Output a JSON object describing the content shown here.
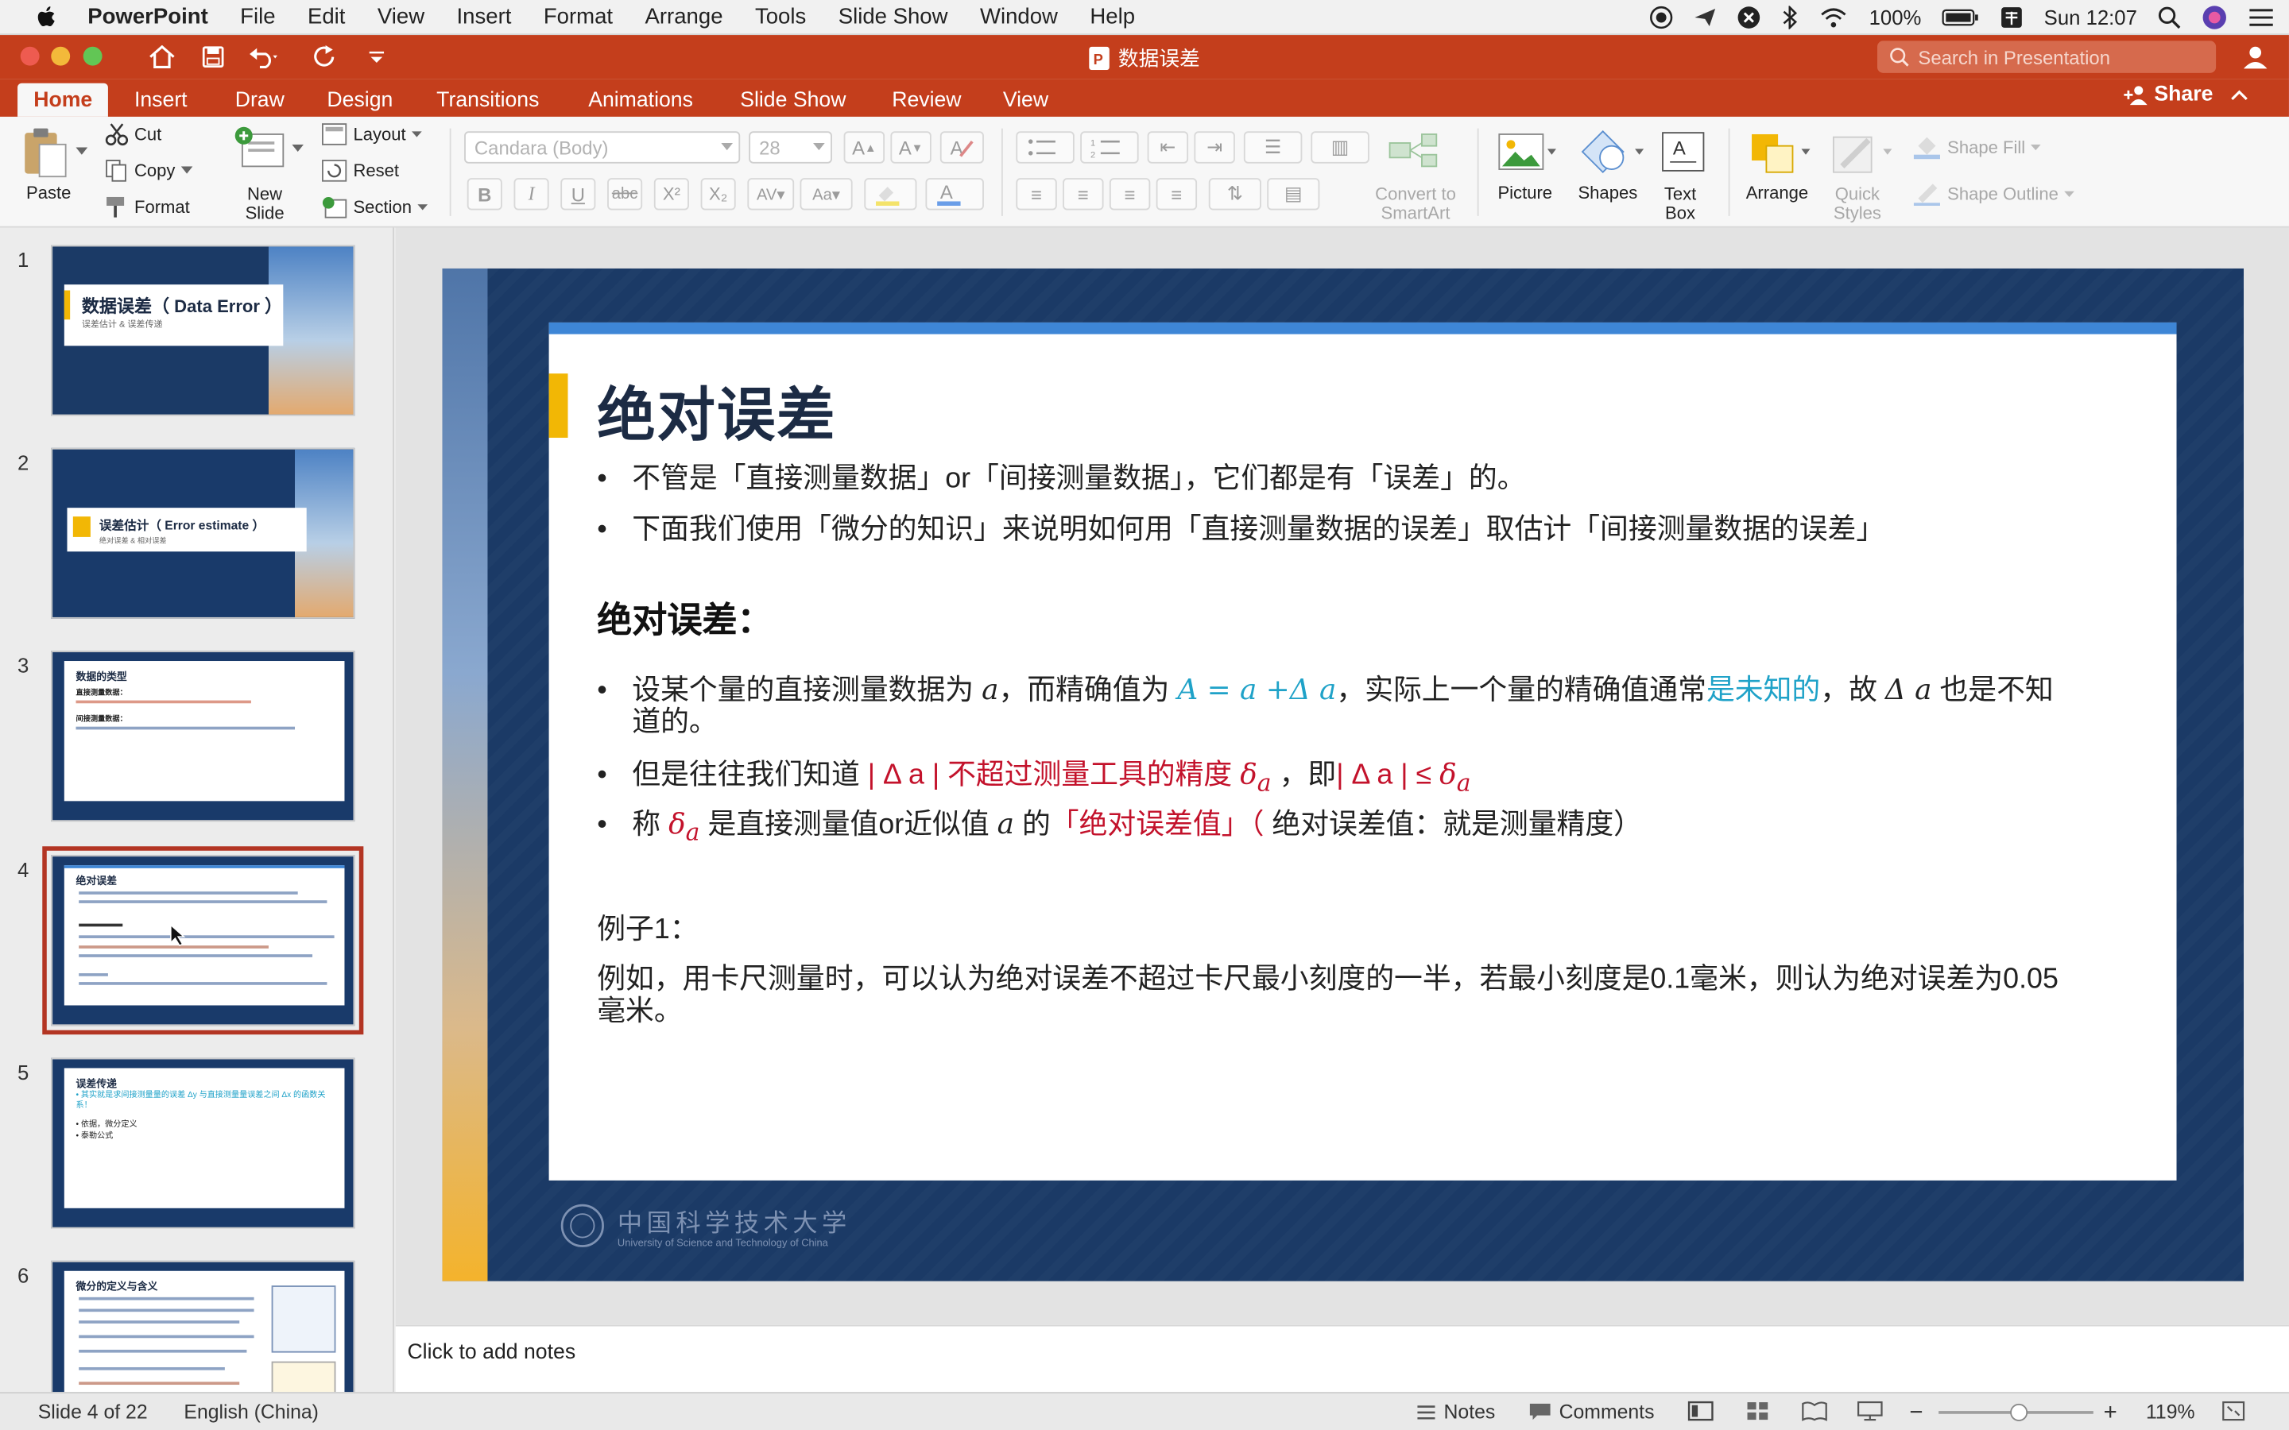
{
  "menubar": {
    "app": "PowerPoint",
    "items": [
      "File",
      "Edit",
      "View",
      "Insert",
      "Format",
      "Arrange",
      "Tools",
      "Slide Show",
      "Window",
      "Help"
    ],
    "battery": "100%",
    "clock": "Sun 12:07"
  },
  "window": {
    "title": "数据误差",
    "search_placeholder": "Search in Presentation",
    "share": "Share"
  },
  "tabs": [
    "Home",
    "Insert",
    "Draw",
    "Design",
    "Transitions",
    "Animations",
    "Slide Show",
    "Review",
    "View"
  ],
  "ribbon": {
    "paste": "Paste",
    "cut": "Cut",
    "copy": "Copy",
    "format": "Format",
    "new_slide_1": "New",
    "new_slide_2": "Slide",
    "layout": "Layout",
    "reset": "Reset",
    "section": "Section",
    "font_name": "Candara (Body)",
    "font_size": "28",
    "convert_1": "Convert to",
    "convert_2": "SmartArt",
    "picture": "Picture",
    "shapes": "Shapes",
    "textbox_1": "Text",
    "textbox_2": "Box",
    "arrange": "Arrange",
    "quick_1": "Quick",
    "quick_2": "Styles",
    "shape_fill": "Shape Fill",
    "shape_outline": "Shape Outline"
  },
  "thumbnails": [
    {
      "num": "1",
      "title": "数据误差（ Data Error ）",
      "sub": "误差估计 & 误差传递"
    },
    {
      "num": "2",
      "title": "误差估计（ Error estimate ）",
      "sub": "绝对误差 & 相对误差"
    },
    {
      "num": "3",
      "title": "数据的类型",
      "line1": "直接测量数据：",
      "line2": "间接测量数据："
    },
    {
      "num": "4",
      "title": "绝对误差"
    },
    {
      "num": "5",
      "title": "误差传递",
      "line1": "• 其实就是求间接测量量的误差 Δy 与直接测量量误差之间 Δx 的函数关系！",
      "line2": "• 依据，微分定义",
      "line3": "• 泰勒公式"
    },
    {
      "num": "6",
      "title": "微分的定义与含义"
    }
  ],
  "slide": {
    "title": "绝对误差",
    "bullet1": "不管是「直接测量数据」or「间接测量数据」，它们都是有「误差」的。",
    "bullet2": "下面我们使用「微分的知识」来说明如何用「直接测量数据的误差」取估计「间接测量数据的误差」",
    "subhead": "绝对误差：",
    "b3_a": "设某个量的直接测量数据为",
    "b3_b": "，而精确值为",
    "b3_formula": "A = a +Δ a",
    "b3_c": "，实际上一个量的精确值通常",
    "b3_d": "是未知的",
    "b3_e": "，故",
    "b3_f": "也是不知",
    "b3_g": "道的。",
    "b4_a": "但是往往我们知道",
    "b4_b": "| Δ a | 不超过测量工具的精度",
    "b4_c": "，即",
    "b4_d": "| Δ a | ≤",
    "b5_a": "称",
    "b5_b": "是直接测量值or近似值",
    "b5_c": "的",
    "b5_d": "「绝对误差值」（",
    "b5_e": "绝对误差值：就是测量精度）",
    "var_a": "a",
    "var_da": "Δ a",
    "var_delta": "δ",
    "var_sub": "a",
    "ex_label": "例子1：",
    "ex_line1": "例如，用卡尺测量时，可以认为绝对误差不超过卡尺最小刻度的一半，若最小刻度是0.1毫米，则认为绝对误差为0.05",
    "ex_line2": "毫米。",
    "footer_cn": "中国科学技术大学",
    "footer_en": "University of Science and Technology of China"
  },
  "notes": "Click to add notes",
  "status": {
    "slide": "Slide 4 of 22",
    "lang": "English (China)",
    "notes": "Notes",
    "comments": "Comments",
    "zoom": "119%"
  },
  "colors": {
    "accent": "#c43e1c",
    "slide_bg": "#1b3a66",
    "cyan": "#1fa2c8",
    "red": "#c3122b",
    "yellow": "#f2b705",
    "blue_bar": "#3e86d6"
  }
}
